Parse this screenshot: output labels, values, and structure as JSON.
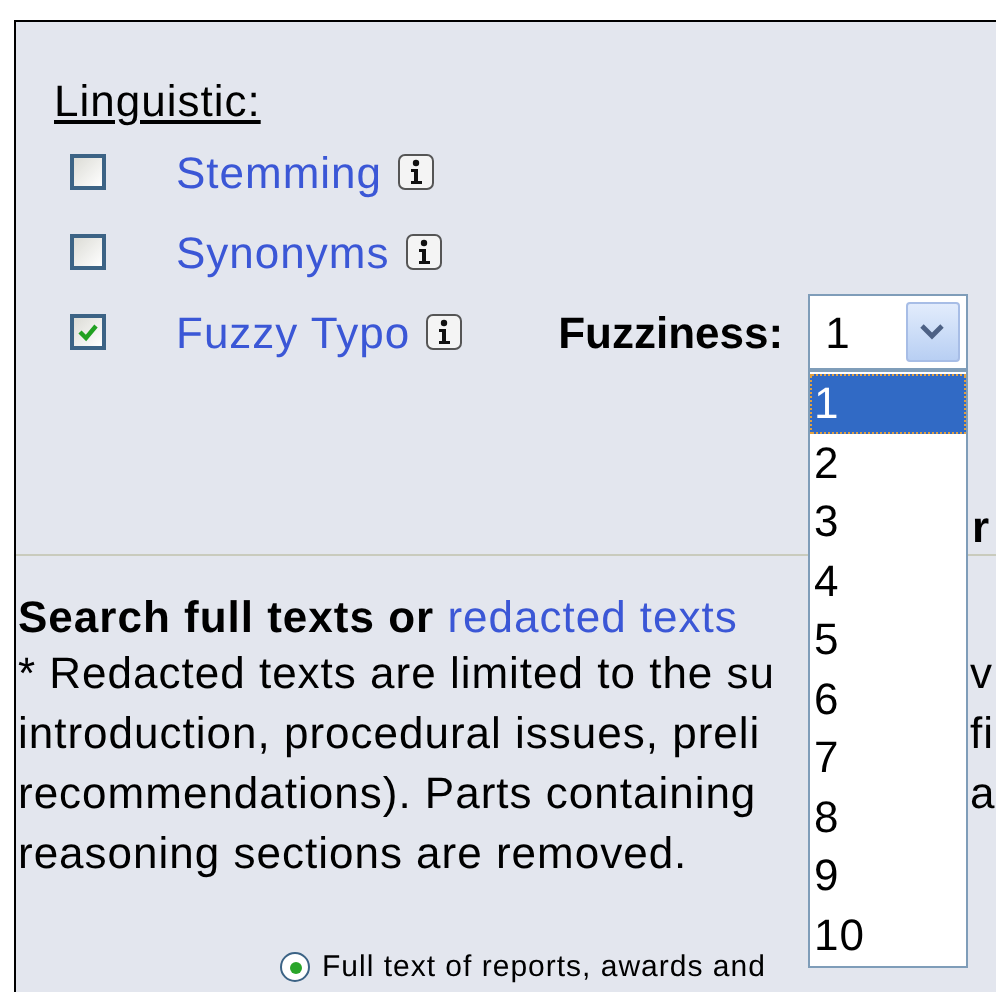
{
  "linguistic": {
    "title": "Linguistic:",
    "options": [
      {
        "label": "Stemming",
        "checked": false
      },
      {
        "label": "Synonyms",
        "checked": false
      },
      {
        "label": "Fuzzy Typo",
        "checked": true
      }
    ]
  },
  "fuzziness": {
    "label": "Fuzziness:",
    "value": "1",
    "options": [
      {
        "label": "1",
        "selected": true
      },
      {
        "label": "2",
        "selected": false
      },
      {
        "label": "3",
        "selected": false
      },
      {
        "label": "4",
        "selected": false
      },
      {
        "label": "5",
        "selected": false
      },
      {
        "label": "6",
        "selected": false
      },
      {
        "label": "7",
        "selected": false
      },
      {
        "label": "8",
        "selected": false
      },
      {
        "label": "9",
        "selected": false
      },
      {
        "label": "10",
        "selected": false
      }
    ]
  },
  "heading_fragment": "r",
  "search_section": {
    "title": "Search full texts or",
    "link": "redacted texts",
    "note_lines": [
      {
        "left": "* Redacted texts are limited to the su",
        "right": "v"
      },
      {
        "left": "introduction, procedural issues, preli",
        "right": "fi"
      },
      {
        "left": "recommendations). Parts containing",
        "right": "a"
      },
      {
        "left": "reasoning sections are removed."
      }
    ]
  },
  "scope_options": [
    {
      "label": "Full text of reports, awards and",
      "selected": true
    }
  ]
}
